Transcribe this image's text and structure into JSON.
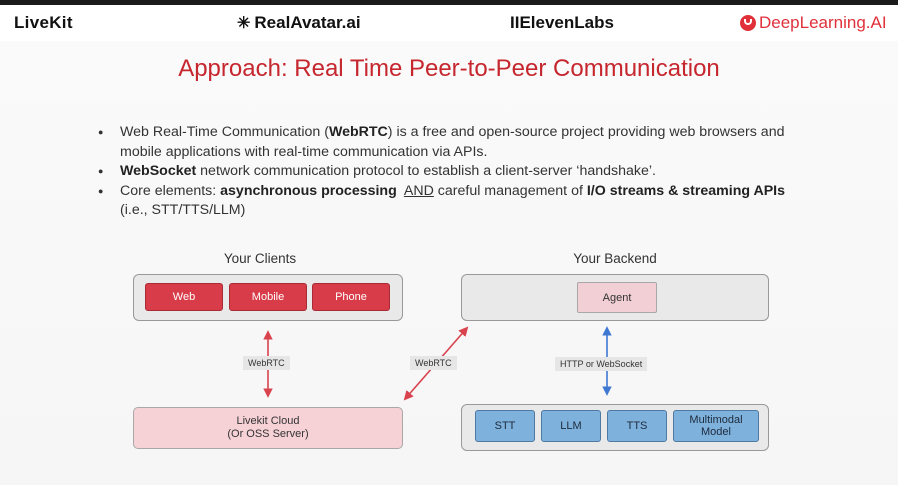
{
  "header": {
    "logos": [
      {
        "name": "LiveKit",
        "text": "LiveKit"
      },
      {
        "name": "RealAvatar.ai",
        "text": "RealAvatar.ai"
      },
      {
        "name": "ElevenLabs",
        "text": "IIElevenLabs"
      },
      {
        "name": "DeepLearning.AI",
        "text": "DeepLearning.AI"
      }
    ]
  },
  "slide": {
    "title": "Approach: Real Time Peer-to-Peer Communication",
    "bullet1": {
      "pre": "Web Real-Time Communication (",
      "bold": "WebRTC",
      "post": ") is a free and open-source project providing web browsers and mobile applications with real-time communication via APIs."
    },
    "bullet2": {
      "bold": "WebSocket",
      "post": " network communication protocol to establish a client-server ‘handshake’."
    },
    "bullet3": {
      "pre": "Core elements: ",
      "bold1": "asynchronous processing",
      "and": "AND",
      "mid": " careful management of ",
      "bold2": "I/O streams & streaming APIs",
      "post": " (i.e., STT/TTS/LLM)"
    }
  },
  "diagram": {
    "clients_label": "Your Clients",
    "backend_label": "Your Backend",
    "clients": [
      "Web",
      "Mobile",
      "Phone"
    ],
    "agent": "Agent",
    "cloud_line1": "Livekit Cloud",
    "cloud_line2": "(Or OSS Server)",
    "services": [
      "STT",
      "LLM",
      "TTS",
      "Multimodal Model"
    ],
    "conn_left": "WebRTC",
    "conn_mid": "WebRTC",
    "conn_right": "HTTP or WebSocket"
  },
  "colors": {
    "title": "#c6262e",
    "client_button": "#d83c48",
    "service_button": "#7fb1dd",
    "webrtc_arrow": "#d9434e",
    "http_arrow": "#3f78d2"
  }
}
